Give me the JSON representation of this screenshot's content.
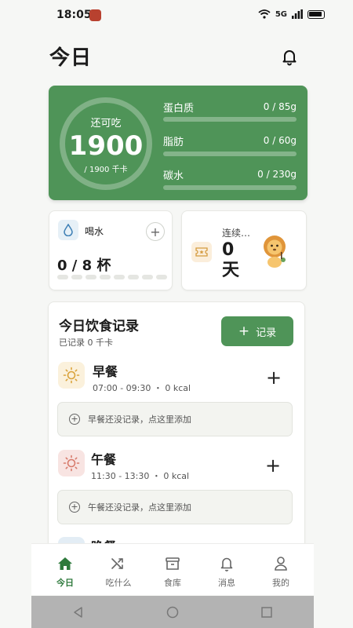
{
  "status_bar": {
    "time": "18:05",
    "network": "5G"
  },
  "header": {
    "title": "今日"
  },
  "summary": {
    "remain_label": "还可吃",
    "remain_value": "1900",
    "remain_total": "/ 1900 千卡",
    "macros": [
      {
        "name": "蛋白质",
        "value": "0 / 85g",
        "progress": 0
      },
      {
        "name": "脂肪",
        "value": "0 / 60g",
        "progress": 0
      },
      {
        "name": "碳水",
        "value": "0 / 230g",
        "progress": 0
      }
    ],
    "accent": "#4f9458"
  },
  "water": {
    "label": "喝水",
    "count": "0 / 8 杯",
    "cups_total": 8,
    "cups_filled": 0,
    "add_icon": "plus-icon"
  },
  "streak": {
    "label": "连续…",
    "value": "0 天"
  },
  "food_log": {
    "title": "今日饮食记录",
    "subtitle": "已记录 0 千卡",
    "record_button": "记录",
    "meals": [
      {
        "name": "早餐",
        "meta": "07:00 - 09:30 ・ 0 kcal",
        "empty_text": "早餐还没记录，点这里添加",
        "icon": "sun-icon",
        "icon_bg": "#fbf1dc",
        "icon_color": "#d9a23a"
      },
      {
        "name": "午餐",
        "meta": "11:30 - 13:30 ・ 0 kcal",
        "empty_text": "午餐还没记录，点这里添加",
        "icon": "sun-icon",
        "icon_bg": "#f8e4e2",
        "icon_color": "#d77a6b"
      },
      {
        "name": "晚餐"
      }
    ]
  },
  "tabs": [
    {
      "label": "今日",
      "icon": "home-icon",
      "active": true
    },
    {
      "label": "吃什么",
      "icon": "shuffle-icon",
      "active": false
    },
    {
      "label": "食库",
      "icon": "archive-icon",
      "active": false
    },
    {
      "label": "消息",
      "icon": "bell-icon",
      "active": false
    },
    {
      "label": "我的",
      "icon": "user-icon",
      "active": false
    }
  ]
}
